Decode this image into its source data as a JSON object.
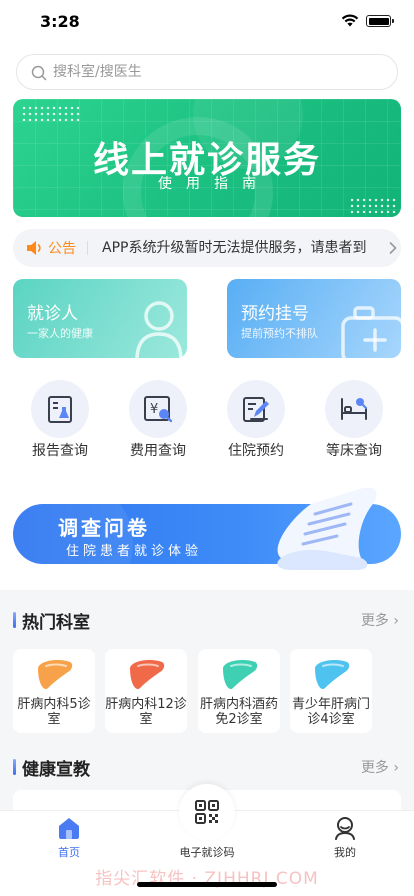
{
  "status_bar": {
    "time": "3:28"
  },
  "search": {
    "placeholder": "搜科室/搜医生"
  },
  "banner": {
    "title": "线上就诊服务",
    "subtitle": "使用指南"
  },
  "notice": {
    "label": "公告",
    "text": "APP系统升级暂时无法提供服务，请患者到"
  },
  "cards": [
    {
      "title": "就诊人",
      "subtitle": "一家人的健康"
    },
    {
      "title": "预约挂号",
      "subtitle": "提前预约不排队"
    }
  ],
  "shortcuts": [
    {
      "label": "报告查询",
      "icon": "report-icon"
    },
    {
      "label": "费用查询",
      "icon": "fee-icon"
    },
    {
      "label": "住院预约",
      "icon": "hospitalization-icon"
    },
    {
      "label": "等床查询",
      "icon": "bed-icon"
    }
  ],
  "survey": {
    "title": "调查问卷",
    "subtitle": "住院患者就诊体验"
  },
  "hot_departments": {
    "title": "热门科室",
    "more": "更多",
    "items": [
      {
        "name": "肝病内科5诊室",
        "color": "#f7a24a"
      },
      {
        "name": "肝病内科12诊室",
        "color": "#f06a4a"
      },
      {
        "name": "肝病内科酒药免2诊室",
        "color": "#3fd0b3"
      },
      {
        "name": "青少年肝病门诊4诊室",
        "color": "#4fc3f0"
      }
    ]
  },
  "health_education": {
    "title": "健康宣教",
    "more": "更多"
  },
  "tabbar": {
    "home": "首页",
    "code": "电子就诊码",
    "mine": "我的"
  },
  "watermark": "指尖汇软件 · ZJHHRJ.COM",
  "colors": {
    "accent": "#3d6ff0",
    "banner_green": "#1bbf80",
    "notice_orange": "#ff8a1c"
  }
}
